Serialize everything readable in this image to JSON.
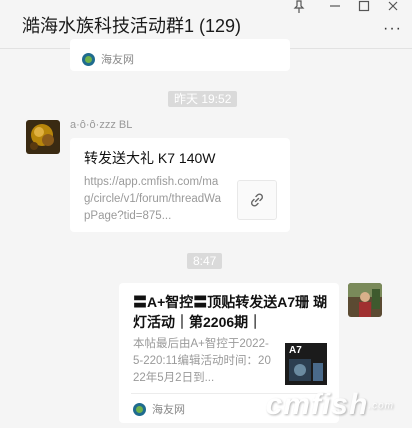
{
  "window": {
    "title": "澔海水族科技活动群1 (129)",
    "more_label": "···",
    "pin_icon": "pin-icon",
    "minimize_icon": "minimize-icon",
    "maximize_icon": "maximize-icon",
    "close_icon": "close-icon"
  },
  "messages": {
    "prev_card": {
      "source": "海友网"
    },
    "time1": "昨天 19:52",
    "msg1": {
      "sender": "a·ô·ô·zzz BL",
      "title": "转发送大礼 K7 140W",
      "desc": "https://app.cmfish.com/mag/circle/v1/forum/threadWapPage?tid=875..."
    },
    "time2": "8:47",
    "msg2": {
      "title": "〓A+智控〓顶贴转发送A7珊 瑚灯活动｜第2206期｜",
      "desc": "本帖最后由A+智控于2022-5-220:11编辑活动时间：2022年5月2日到...",
      "source": "海友网",
      "thumb_label": "A7"
    }
  },
  "watermark": {
    "text": "cmfish",
    "suffix": ".com"
  }
}
